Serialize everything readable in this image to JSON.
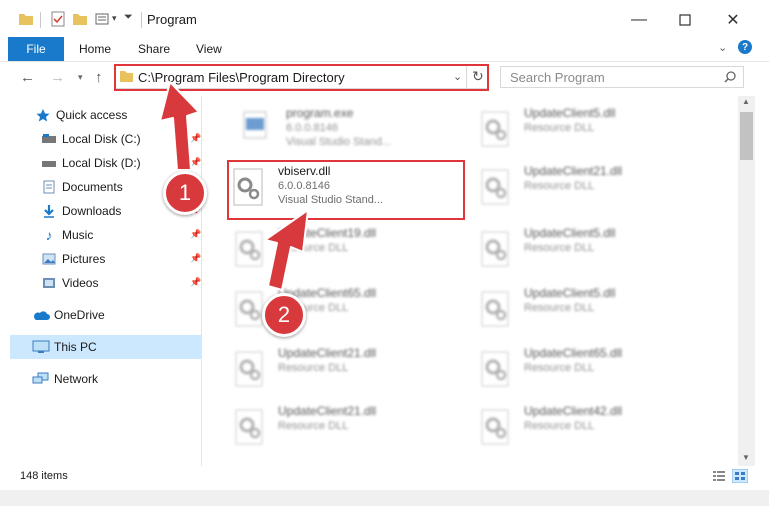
{
  "window": {
    "title": "Program"
  },
  "ribbon": {
    "file": "File",
    "tabs": [
      "Home",
      "Share",
      "View"
    ]
  },
  "address": {
    "path": "C:\\Program Files\\Program Directory"
  },
  "search": {
    "placeholder": "Search Program"
  },
  "sidebar": {
    "items": [
      {
        "label": "Quick access",
        "icon": "star-icon",
        "pinned": false
      },
      {
        "label": "Local Disk (C:)",
        "icon": "drive-icon",
        "pinned": true
      },
      {
        "label": "Local Disk (D:)",
        "icon": "drive-icon",
        "pinned": true
      },
      {
        "label": "Documents",
        "icon": "documents-icon",
        "pinned": true
      },
      {
        "label": "Downloads",
        "icon": "download-icon",
        "pinned": true
      },
      {
        "label": "Music",
        "icon": "music-icon",
        "pinned": true
      },
      {
        "label": "Pictures",
        "icon": "pictures-icon",
        "pinned": true
      },
      {
        "label": "Videos",
        "icon": "videos-icon",
        "pinned": true
      },
      {
        "label": "OneDrive",
        "icon": "cloud-icon",
        "pinned": false
      },
      {
        "label": "This PC",
        "icon": "computer-icon",
        "pinned": false,
        "selected": true
      },
      {
        "label": "Network",
        "icon": "network-icon",
        "pinned": false
      }
    ]
  },
  "files": [
    {
      "name": "program.exe",
      "version": "6.0.0.8146",
      "desc": "Visual Studio Stand...",
      "blurred": true
    },
    {
      "name": "UpdateClient5.dll",
      "version": "",
      "desc": "Resource DLL",
      "blurred": true
    },
    {
      "name": "vbiserv.dll",
      "version": "6.0.0.8146",
      "desc": "Visual Studio Stand...",
      "blurred": false,
      "highlighted": true
    },
    {
      "name": "UpdateClient21.dll",
      "version": "",
      "desc": "Resource DLL",
      "blurred": true
    },
    {
      "name": "UpdateClient19.dll",
      "version": "",
      "desc": "Resource DLL",
      "blurred": true
    },
    {
      "name": "UpdateClient5.dll",
      "version": "",
      "desc": "Resource DLL",
      "blurred": true
    },
    {
      "name": "UpdateClient65.dll",
      "version": "",
      "desc": "Resource DLL",
      "blurred": true
    },
    {
      "name": "UpdateClient5.dll",
      "version": "",
      "desc": "Resource DLL",
      "blurred": true
    },
    {
      "name": "UpdateClient21.dll",
      "version": "",
      "desc": "Resource DLL",
      "blurred": true
    },
    {
      "name": "UpdateClient65.dll",
      "version": "",
      "desc": "Resource DLL",
      "blurred": true
    },
    {
      "name": "UpdateClient21.dll",
      "version": "",
      "desc": "Resource DLL",
      "blurred": true
    },
    {
      "name": "UpdateClient42.dll",
      "version": "",
      "desc": "Resource DLL",
      "blurred": true
    }
  ],
  "status": {
    "count": "148 items"
  },
  "annotations": {
    "step1": "1",
    "step2": "2",
    "accent": "#e0353b"
  },
  "colors": {
    "file_tab": "#1979ca",
    "selected": "#cce8ff"
  }
}
